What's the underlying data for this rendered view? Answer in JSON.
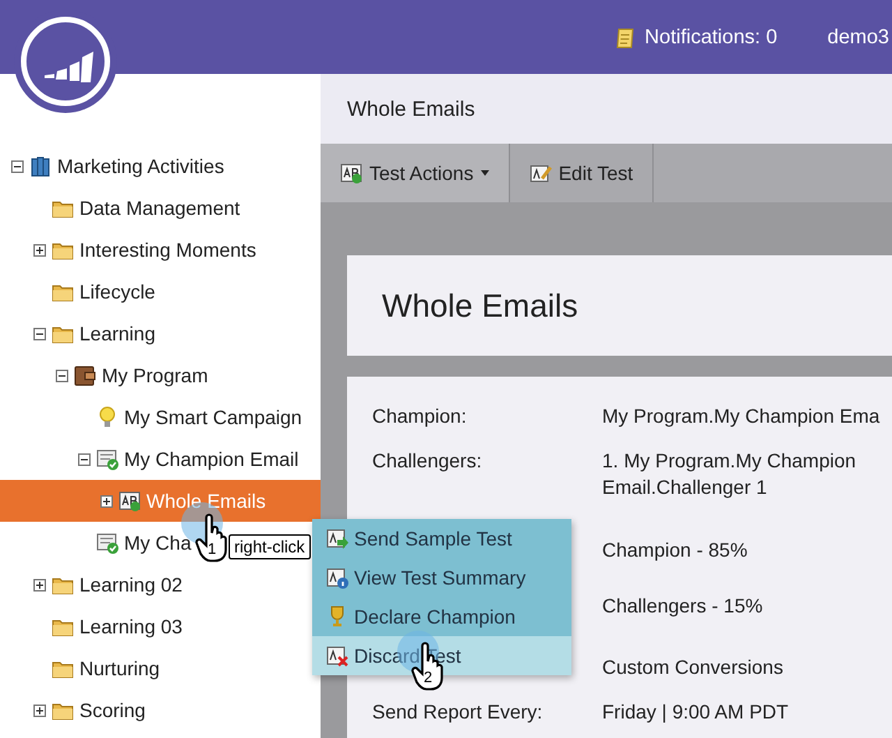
{
  "header": {
    "notifications": "Notifications: 0",
    "user": "demo3"
  },
  "tree": [
    {
      "label": "Marketing Activities",
      "kind": "book",
      "expanded": true,
      "selected": false,
      "children": [
        {
          "label": "Data Management",
          "kind": "folder",
          "selected": false
        },
        {
          "label": "Interesting Moments",
          "kind": "folder",
          "expanded": false,
          "selected": false
        },
        {
          "label": "Lifecycle",
          "kind": "folder",
          "selected": false
        },
        {
          "label": "Learning",
          "kind": "folder",
          "expanded": true,
          "selected": false,
          "children": [
            {
              "label": "My Program",
              "kind": "program",
              "expanded": true,
              "selected": false,
              "children": [
                {
                  "label": "My Smart Campaign",
                  "kind": "bulb",
                  "selected": false
                },
                {
                  "label": "My Champion Email",
                  "kind": "email",
                  "expanded": true,
                  "selected": false,
                  "children": [
                    {
                      "label": "Whole Emails",
                      "kind": "test",
                      "expanded": false,
                      "selected": true
                    }
                  ]
                },
                {
                  "label": "My Cha",
                  "kind": "email",
                  "selected": false
                }
              ]
            }
          ]
        },
        {
          "label": "Learning 02",
          "kind": "folder",
          "expanded": false,
          "selected": false
        },
        {
          "label": "Learning 03",
          "kind": "folder",
          "selected": false
        },
        {
          "label": "Nurturing",
          "kind": "folder",
          "selected": false
        },
        {
          "label": "Scoring",
          "kind": "folder",
          "expanded": false,
          "selected": false
        }
      ]
    }
  ],
  "page_title": "Whole Emails",
  "toolbar": [
    {
      "label": "Test Actions",
      "kind": "test",
      "dropdown": true
    },
    {
      "label": "Edit Test",
      "kind": "edit",
      "dropdown": false
    }
  ],
  "card_title": "Whole Emails",
  "details": [
    {
      "label": "Champion:",
      "value": "My Program.My Champion Ema"
    },
    {
      "label": "Challengers:",
      "value": "1. My Program.My Champion Email.Challenger 1"
    },
    {
      "value": "Champion - 85%"
    },
    {
      "value": "Challengers - 15%"
    },
    {
      "value": "Custom Conversions"
    },
    {
      "label": "Send Report Every:",
      "value": "Friday | 9:00 AM PDT"
    }
  ],
  "context_menu": [
    {
      "label": "Send Sample Test",
      "kind": "send",
      "selected": false
    },
    {
      "label": "View Test Summary",
      "kind": "info",
      "selected": false
    },
    {
      "label": "Declare Champion",
      "kind": "trophy",
      "selected": false
    },
    {
      "label": "Discard Test",
      "kind": "discard",
      "selected": true
    }
  ],
  "annotations": [
    {
      "number": "1",
      "label": "right-click"
    },
    {
      "number": "2"
    }
  ]
}
